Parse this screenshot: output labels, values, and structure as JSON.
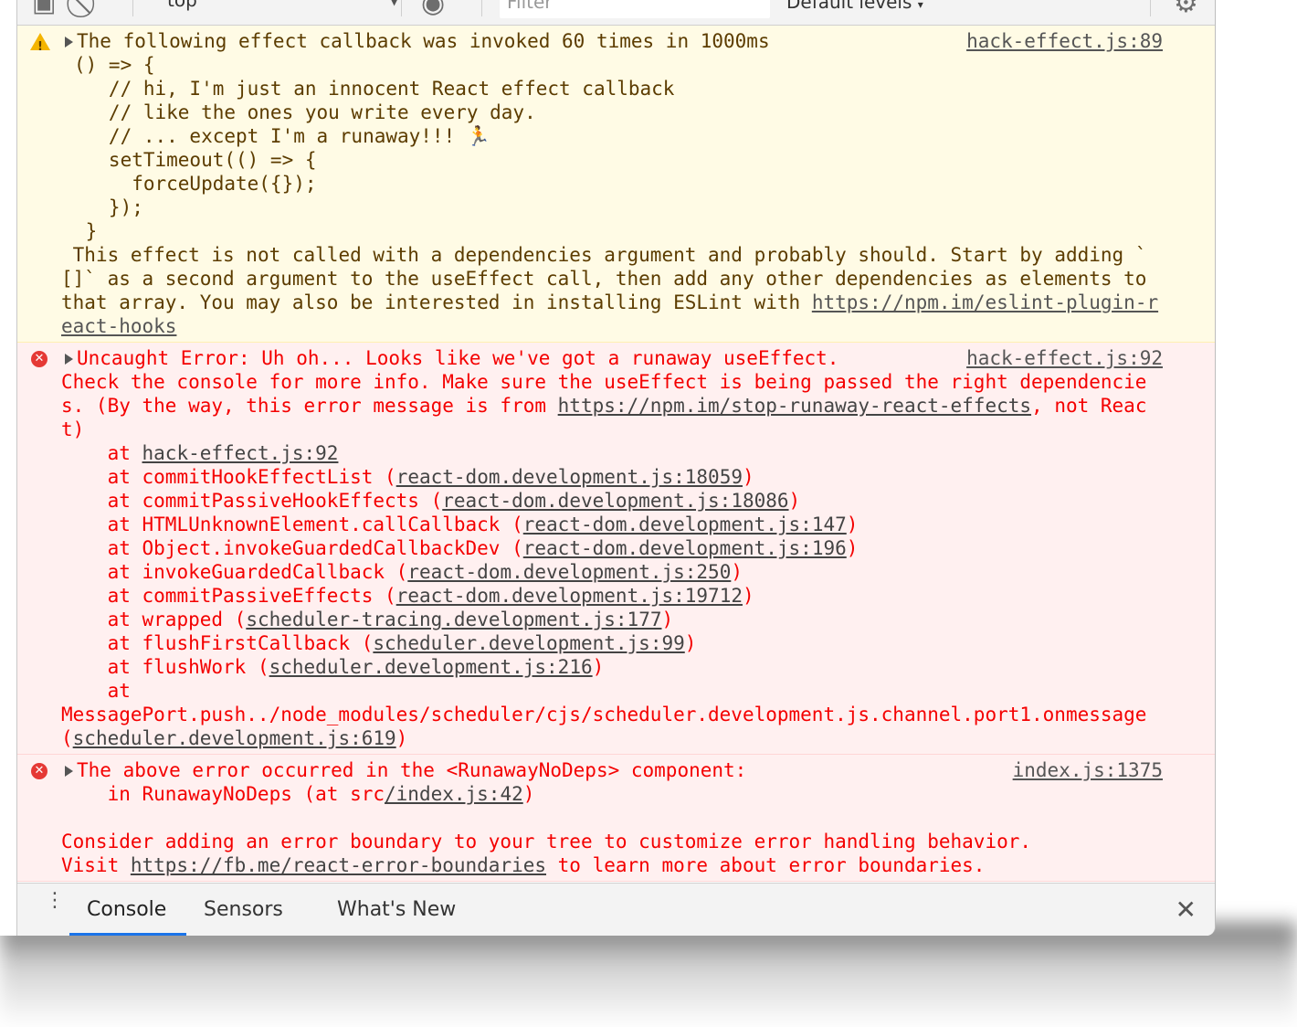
{
  "toolbar": {
    "context": "top",
    "filter_placeholder": "Filter",
    "levels": "Default levels",
    "levels_arrow": "▾",
    "context_arrow": "▼"
  },
  "messages": {
    "warning": {
      "header": "The following effect callback was invoked 60 times in 1000ms",
      "source": "hack-effect.js:89",
      "code": [
        "() => {",
        "   // hi, I'm just an innocent React effect callback",
        "   // like the ones you write every day.",
        "   // ... except I'm a runaway!!! 🏃",
        "   setTimeout(() => {",
        "     forceUpdate({});",
        "   });",
        " }"
      ],
      "advice": " This effect is not called with a dependencies argument and probably should. Start by adding `[]` as a second argument to the useEffect call, then add any other dependencies as elements to that array. You may also be interested in installing ESLint with ",
      "advice_link": "https://npm.im/eslint-plugin-react-hooks"
    },
    "error1": {
      "header": "Uncaught Error: Uh oh... Looks like we've got a runaway useEffect.",
      "source": "hack-effect.js:92",
      "body": "Check the console for more info. Make sure the useEffect is being passed the right dependencies. (By the way, this error message is from ",
      "body_link": "https://npm.im/stop-runaway-react-effects",
      "body_tail": ", not React)",
      "stack": [
        {
          "fn": "",
          "loc": "hack-effect.js:92"
        },
        {
          "fn": "commitHookEffectList",
          "loc": "react-dom.development.js:18059"
        },
        {
          "fn": "commitPassiveHookEffects",
          "loc": "react-dom.development.js:18086"
        },
        {
          "fn": "HTMLUnknownElement.callCallback",
          "loc": "react-dom.development.js:147"
        },
        {
          "fn": "Object.invokeGuardedCallbackDev",
          "loc": "react-dom.development.js:196"
        },
        {
          "fn": "invokeGuardedCallback",
          "loc": "react-dom.development.js:250"
        },
        {
          "fn": "commitPassiveEffects",
          "loc": "react-dom.development.js:19712"
        },
        {
          "fn": "wrapped",
          "loc": "scheduler-tracing.development.js:177"
        },
        {
          "fn": "flushFirstCallback",
          "loc": "scheduler.development.js:99"
        },
        {
          "fn": "flushWork",
          "loc": "scheduler.development.js:216"
        }
      ],
      "last_at": "at",
      "last_fn": "MessagePort.push../node_modules/scheduler/cjs/scheduler.development.js.channel.port1.onmessage ",
      "last_loc": "scheduler.development.js:619"
    },
    "error2": {
      "header": "The above error occurred in the <RunawayNoDeps> component:",
      "source": "index.js:1375",
      "in_line_prefix": "    in RunawayNoDeps (at src",
      "in_line_link": "/index.js:42",
      "in_line_suffix": ")",
      "consider": "Consider adding an error boundary to your tree to customize error handling behavior.",
      "visit_prefix": "Visit ",
      "visit_link": "https://fb.me/react-error-boundaries",
      "visit_suffix": " to learn more about error boundaries."
    }
  },
  "drawer": {
    "tabs": [
      "Console",
      "Sensors",
      "What's New"
    ],
    "active": "Console",
    "more": "⋮",
    "close": "✕"
  },
  "colors": {
    "warning_bg": "#fffbe5",
    "error_bg": "#fff0f0",
    "error_text": "#f40000",
    "tab_accent": "#1a73e8"
  }
}
